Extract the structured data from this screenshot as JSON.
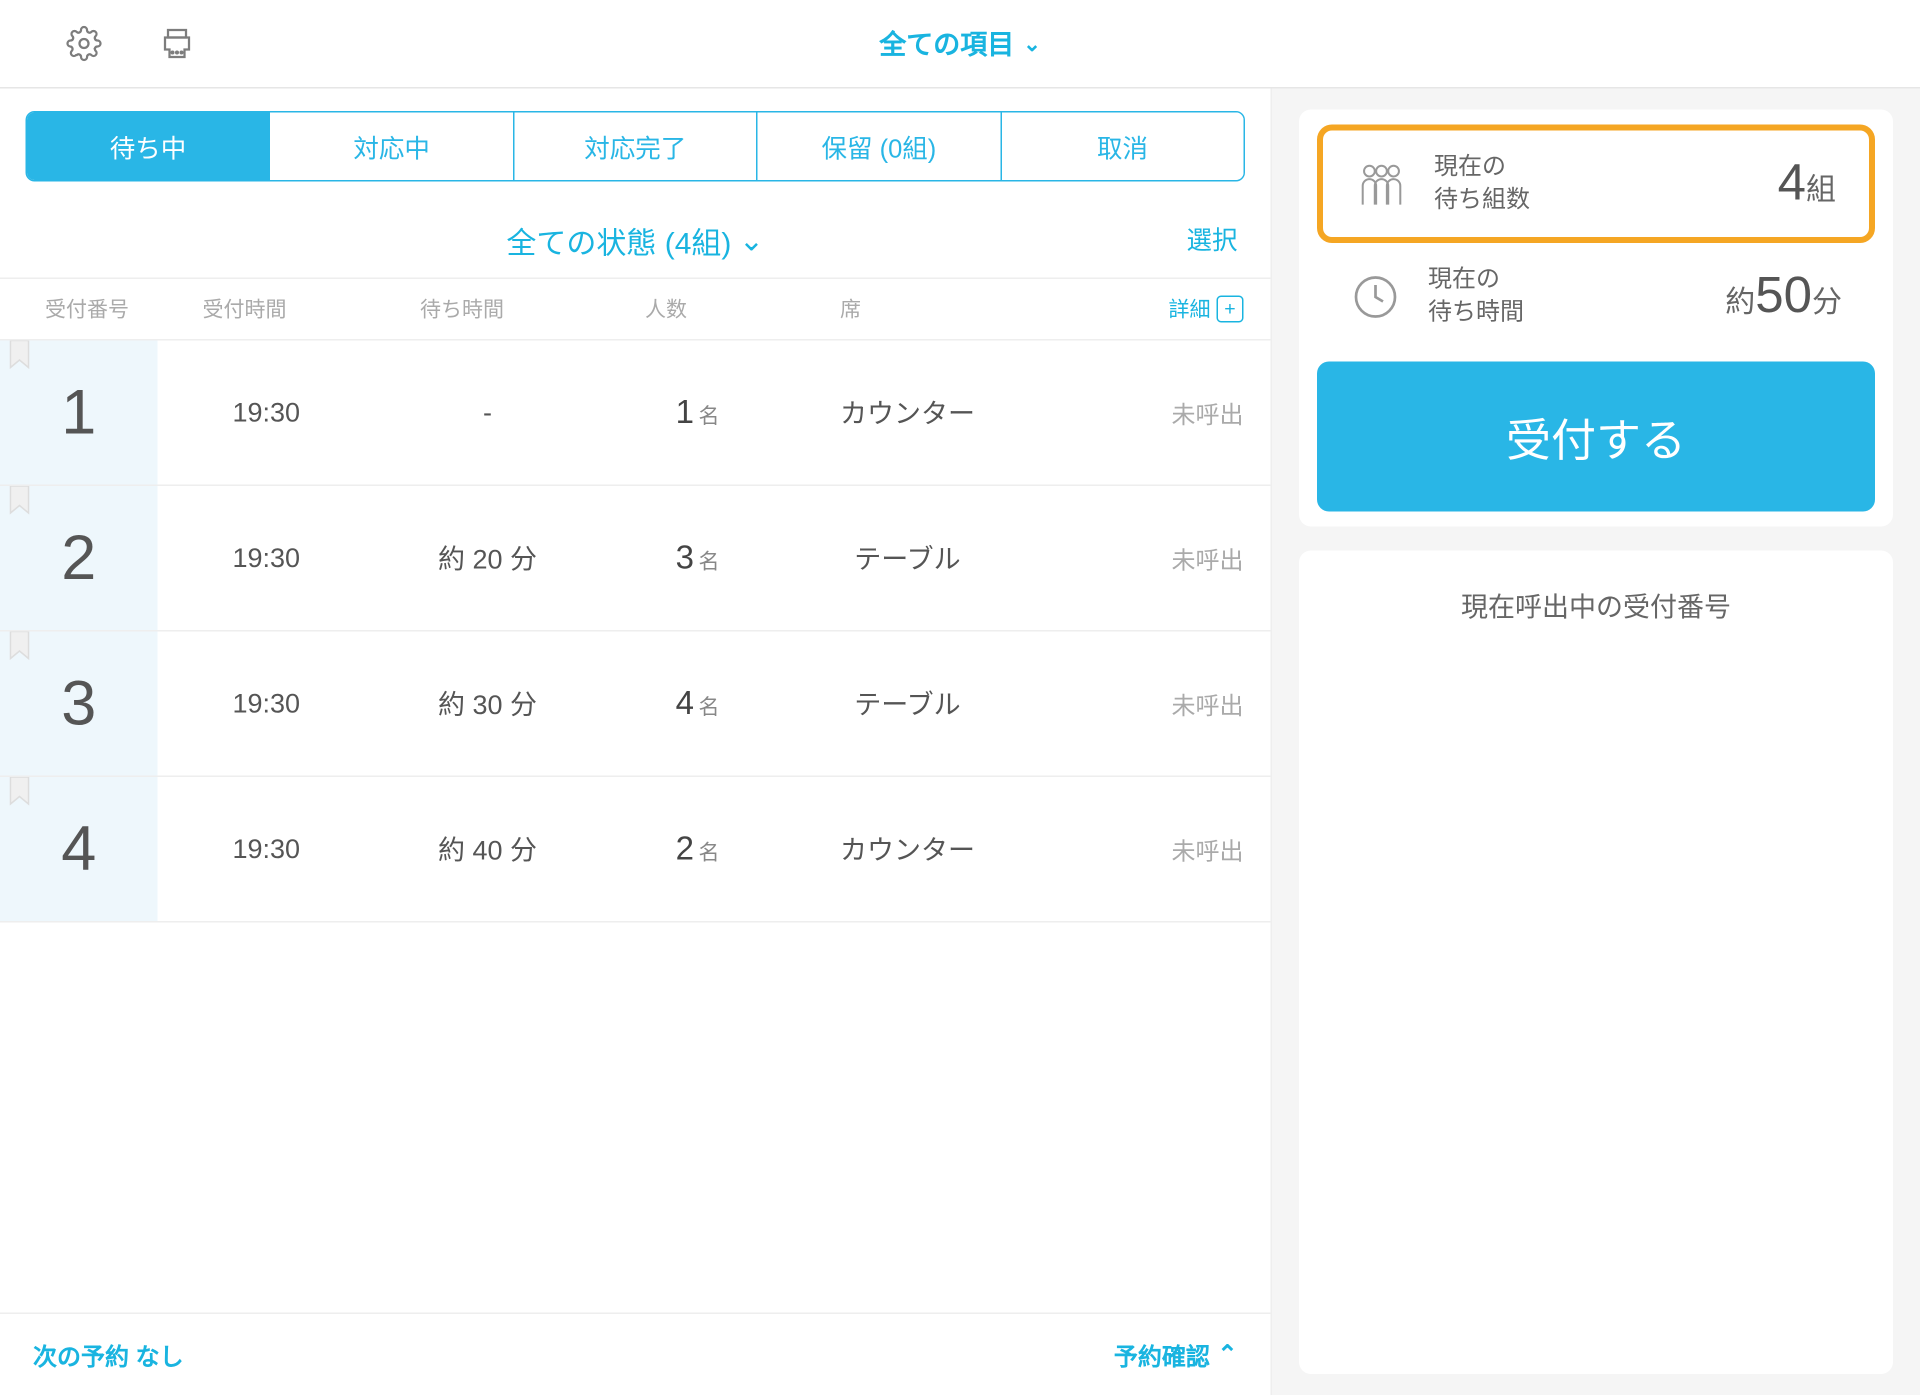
{
  "topbar": {
    "all_items": "全ての項目"
  },
  "tabs": [
    {
      "label": "待ち中",
      "active": true
    },
    {
      "label": "対応中",
      "active": false
    },
    {
      "label": "対応完了",
      "active": false
    },
    {
      "label": "保留 (0組)",
      "active": false
    },
    {
      "label": "取消",
      "active": false
    }
  ],
  "status_filter": {
    "label": "全ての状態 (4組)"
  },
  "select_label": "選択",
  "columns": {
    "c1": "受付番号",
    "c2": "受付時間",
    "c3": "待ち時間",
    "c4": "人数",
    "c5": "席",
    "c6": "詳細"
  },
  "rows": [
    {
      "no": "1",
      "time": "19:30",
      "wait": "-",
      "people": "1",
      "people_suf": "名",
      "seat": "カウンター",
      "status": "未呼出"
    },
    {
      "no": "2",
      "time": "19:30",
      "wait": "約 20 分",
      "people": "3",
      "people_suf": "名",
      "seat": "テーブル",
      "status": "未呼出"
    },
    {
      "no": "3",
      "time": "19:30",
      "wait": "約 30 分",
      "people": "4",
      "people_suf": "名",
      "seat": "テーブル",
      "status": "未呼出"
    },
    {
      "no": "4",
      "time": "19:30",
      "wait": "約 40 分",
      "people": "2",
      "people_suf": "名",
      "seat": "カウンター",
      "status": "未呼出"
    }
  ],
  "bottom": {
    "next": "次の予約 なし",
    "check": "予約確認"
  },
  "right": {
    "wait_count": {
      "l1": "現在の",
      "l2": "待ち組数",
      "num": "4",
      "suf": "組"
    },
    "wait_time": {
      "l1": "現在の",
      "l2": "待ち時間",
      "pre": "約",
      "num": "50",
      "suf": "分"
    },
    "register": "受付する",
    "callout": "現在呼出中の受付番号"
  }
}
